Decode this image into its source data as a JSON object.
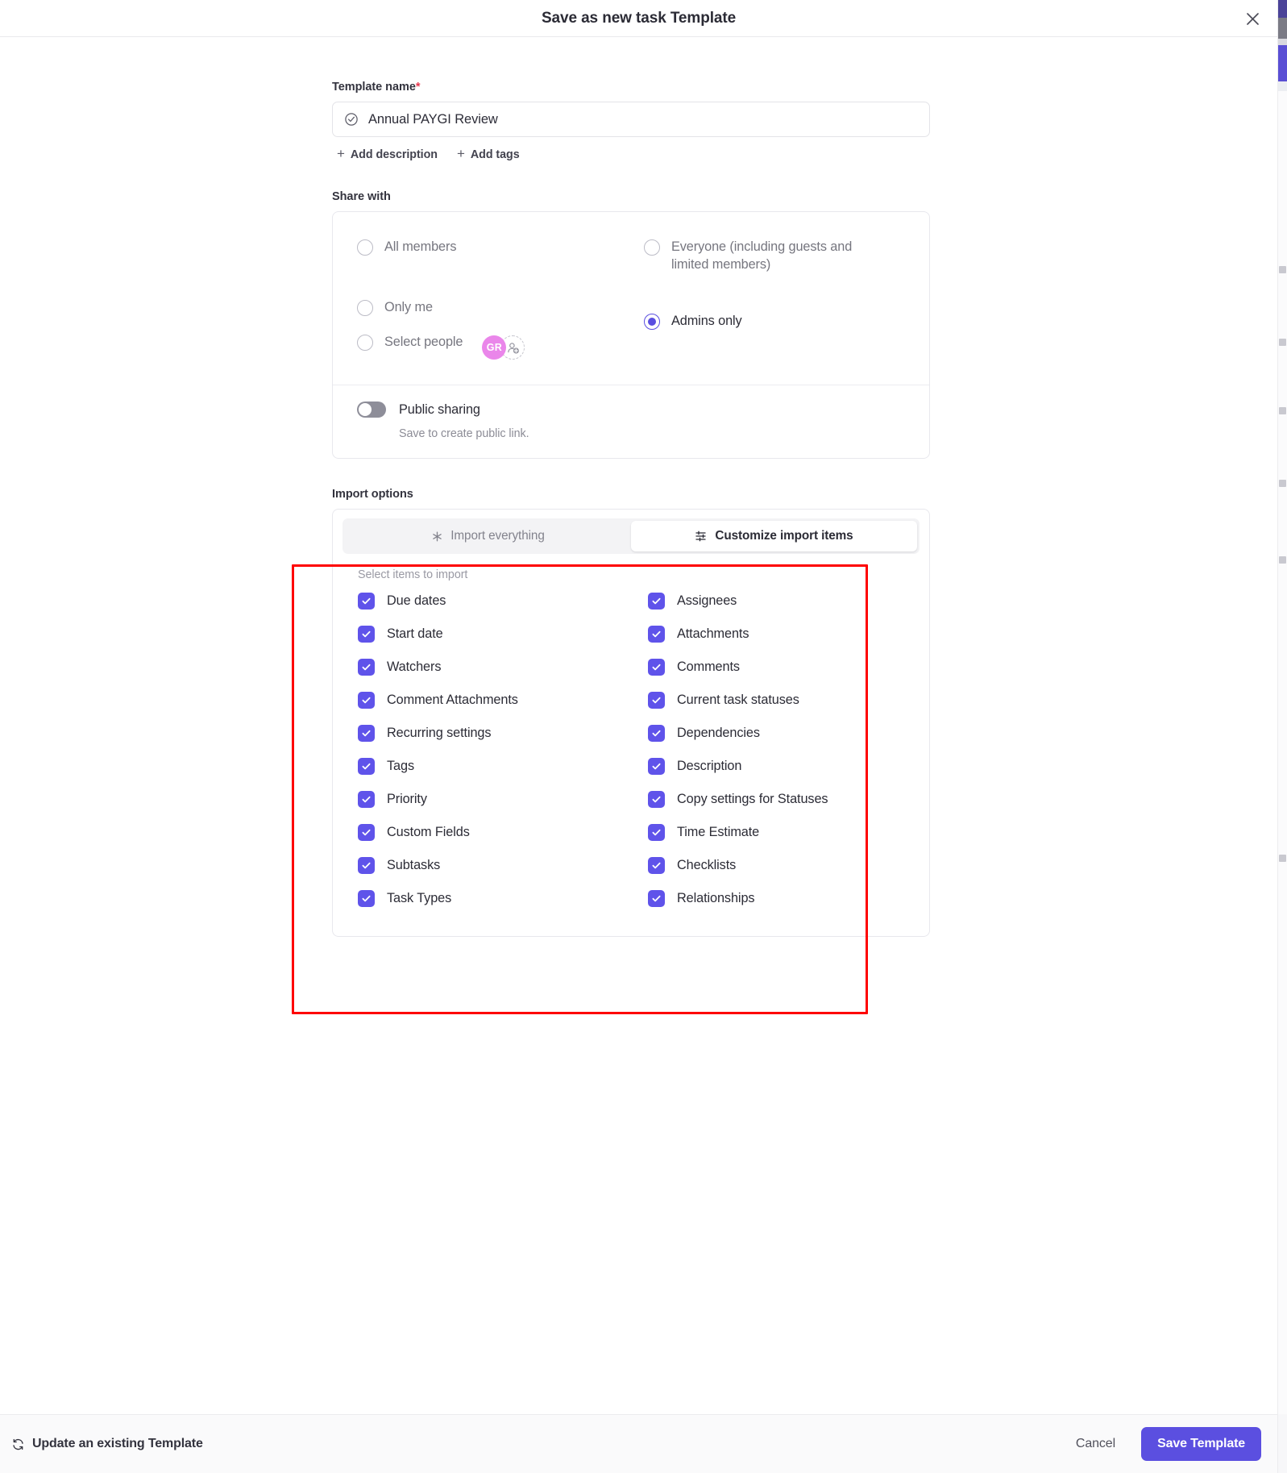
{
  "modal": {
    "title": "Save as new task Template",
    "close_icon": "close-icon"
  },
  "template_name": {
    "label": "Template name",
    "required_marker": "*",
    "value": "Annual PAYGI Review",
    "placeholder": "Template name",
    "icon": "task-check-circle-icon"
  },
  "quick_actions": [
    {
      "label": "Add description",
      "icon": "plus-icon"
    },
    {
      "label": "Add tags",
      "icon": "plus-icon"
    }
  ],
  "share_with": {
    "label": "Share with",
    "options": [
      {
        "label": "All members",
        "checked": false,
        "column": "left"
      },
      {
        "label": "Only me",
        "checked": false,
        "column": "left"
      },
      {
        "label": "Select people",
        "checked": false,
        "column": "left",
        "has_people": true
      },
      {
        "label": "Everyone (including guests and limited members)",
        "checked": false,
        "column": "right"
      },
      {
        "label": "Admins only",
        "checked": true,
        "column": "right"
      }
    ],
    "people": {
      "avatar_initials": "GR",
      "avatar_color": "#ea86ea",
      "add_person_icon": "add-person-icon"
    },
    "public_sharing": {
      "label": "Public sharing",
      "enabled": false,
      "hint": "Save to create public link."
    }
  },
  "import_options": {
    "label": "Import options",
    "tabs": [
      {
        "label": "Import everything",
        "active": false,
        "icon": "asterisk-icon"
      },
      {
        "label": "Customize import items",
        "active": true,
        "icon": "sliders-icon"
      }
    ],
    "select_hint": "Select items to import",
    "items_left": [
      {
        "label": "Due dates",
        "checked": true
      },
      {
        "label": "Start date",
        "checked": true
      },
      {
        "label": "Watchers",
        "checked": true
      },
      {
        "label": "Comment Attachments",
        "checked": true
      },
      {
        "label": "Recurring settings",
        "checked": true
      },
      {
        "label": "Tags",
        "checked": true
      },
      {
        "label": "Priority",
        "checked": true
      },
      {
        "label": "Custom Fields",
        "checked": true
      },
      {
        "label": "Subtasks",
        "checked": true
      },
      {
        "label": "Task Types",
        "checked": true
      }
    ],
    "items_right": [
      {
        "label": "Assignees",
        "checked": true
      },
      {
        "label": "Attachments",
        "checked": true
      },
      {
        "label": "Comments",
        "checked": true
      },
      {
        "label": "Current task statuses",
        "checked": true
      },
      {
        "label": "Dependencies",
        "checked": true
      },
      {
        "label": "Description",
        "checked": true
      },
      {
        "label": "Copy settings for Statuses",
        "checked": true
      },
      {
        "label": "Time Estimate",
        "checked": true
      },
      {
        "label": "Checklists",
        "checked": true
      },
      {
        "label": "Relationships",
        "checked": true
      }
    ]
  },
  "footer": {
    "update_existing": "Update an existing Template",
    "update_icon": "refresh-icon",
    "cancel": "Cancel",
    "save": "Save Template"
  },
  "colors": {
    "accent": "#5b4fe0",
    "checkbox": "#5f53ea",
    "annotation": "#fe0000",
    "avatar": "#ea86ea"
  }
}
